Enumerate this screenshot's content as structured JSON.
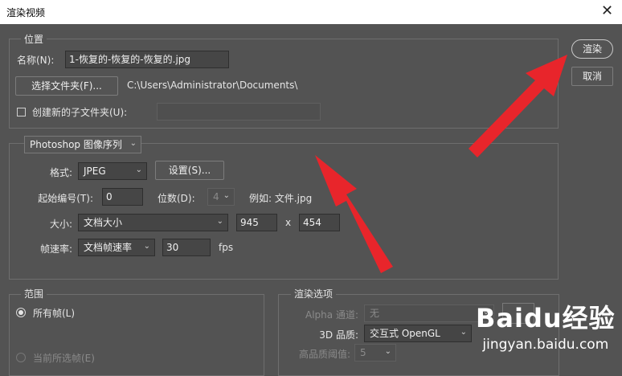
{
  "window": {
    "title": "渲染视频",
    "close_glyph": "✕"
  },
  "location": {
    "legend": "位置",
    "name_label": "名称(N):",
    "name_value": "1-恢复的-恢复的-恢复的.jpg",
    "choose_folder_label": "选择文件夹(F)...",
    "folder_path": "C:\\Users\\Administrator\\Documents\\",
    "create_subfolder_label": "创建新的子文件夹(U):",
    "create_subfolder_checked": false,
    "subfolder_value": ""
  },
  "actions": {
    "render_label": "渲染",
    "cancel_label": "取消"
  },
  "export": {
    "type_selected": "Photoshop 图像序列",
    "format_label": "格式:",
    "format_value": "JPEG",
    "settings_label": "设置(S)...",
    "start_number_label": "起始编号(T):",
    "start_number_value": "0",
    "digits_label": "位数(D):",
    "digits_value": "4",
    "example_text": "例如: 文件.jpg",
    "size_label": "大小:",
    "size_value": "文档大小",
    "width_value": "945",
    "x_label": "x",
    "height_value": "454",
    "frame_rate_label": "帧速率:",
    "frame_rate_select": "文档帧速率",
    "frame_rate_value": "30",
    "fps_label": "fps"
  },
  "range": {
    "legend": "范围",
    "all_frames_label": "所有帧(L)",
    "current_selection_label": "当前所选帧(E)"
  },
  "render_options": {
    "legend": "渲染选项",
    "alpha_label": "Alpha 通道:",
    "alpha_value": "无",
    "quality_label": "3D 品质:",
    "quality_value": "交互式 OpenGL",
    "high_quality_label": "高品质阈值:",
    "high_quality_value": "5"
  },
  "watermark": {
    "brand": "Baidu经验",
    "url": "jingyan.baidu.com"
  },
  "colors": {
    "dialog_bg": "#535353",
    "arrow": "#e8252b",
    "title_bg": "#ffffff"
  }
}
